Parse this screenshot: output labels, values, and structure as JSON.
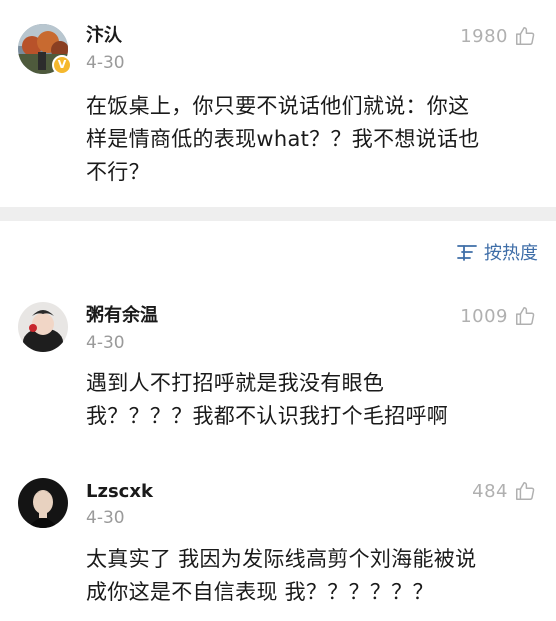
{
  "comments": [
    {
      "username": "汴汄",
      "date": "4-30",
      "likes": "1980",
      "verified_badge": "V",
      "text": "在饭桌上，你只要不说话他们就说：你这\n样是情商低的表现what？？我不想说话也\n不行？"
    },
    {
      "username": "粥有余温",
      "date": "4-30",
      "likes": "1009",
      "text": "遇到人不打招呼就是我没有眼色\n我？？？？我都不认识我打个毛招呼啊"
    },
    {
      "username": "Lzscxk",
      "date": "4-30",
      "likes": "484",
      "text": "太真实了 我因为发际线高剪个刘海能被说\n成你这是不自信表现 我？？？？？？"
    }
  ],
  "sort": {
    "label": "按热度",
    "icon": "sort-icon"
  },
  "colors": {
    "accent": "#3f6ea8",
    "muted": "#9a9a9a",
    "verified": "#f5b82e",
    "divider": "#eeeeee"
  }
}
